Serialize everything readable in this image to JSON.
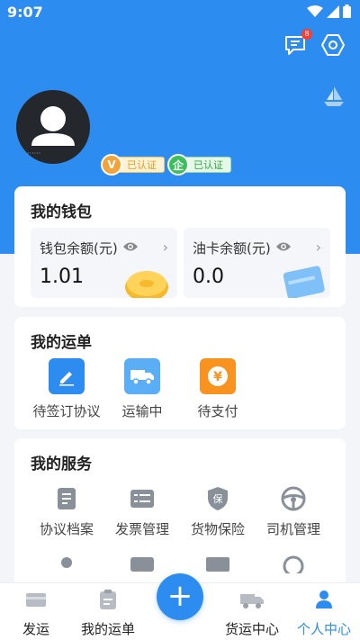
{
  "status_bar": {
    "time": "9:07"
  },
  "header": {
    "message_badge_count": "8",
    "avatar_caption": "······",
    "certifications": [
      {
        "icon_letter": "V",
        "label": "已认证"
      },
      {
        "icon_letter": "企",
        "label": "已认证"
      }
    ]
  },
  "wallet": {
    "title": "我的钱包",
    "wallet_balance": {
      "label": "钱包余额(元)",
      "value": "1.01"
    },
    "fuel_card_balance": {
      "label": "油卡余额(元)",
      "value": "0.0"
    }
  },
  "orders": {
    "title": "我的运单",
    "items": [
      {
        "label": "待签订协议",
        "icon": "pen-icon",
        "color": "#2d8cf0"
      },
      {
        "label": "运输中",
        "icon": "truck-icon",
        "color": "#5aaef5"
      },
      {
        "label": "待支付",
        "icon": "yen-icon",
        "color": "#f7931e"
      }
    ]
  },
  "services": {
    "title": "我的服务",
    "items": [
      {
        "label": "协议档案",
        "icon": "document-icon"
      },
      {
        "label": "发票管理",
        "icon": "invoice-icon"
      },
      {
        "label": "货物保险",
        "icon": "shield-icon"
      },
      {
        "label": "司机管理",
        "icon": "steering-wheel-icon"
      }
    ]
  },
  "tabbar": {
    "tabs": [
      {
        "label": "发运",
        "icon": "ship-icon"
      },
      {
        "label": "我的运单",
        "icon": "clipboard-icon"
      },
      {
        "label": "货运中心",
        "icon": "truck-icon"
      },
      {
        "label": "个人中心",
        "icon": "person-icon",
        "active": true
      }
    ],
    "fab_symbol": "+"
  },
  "colors": {
    "brand": "#2d8cf0",
    "orange": "#f7931e",
    "green": "#3bbf5a"
  }
}
